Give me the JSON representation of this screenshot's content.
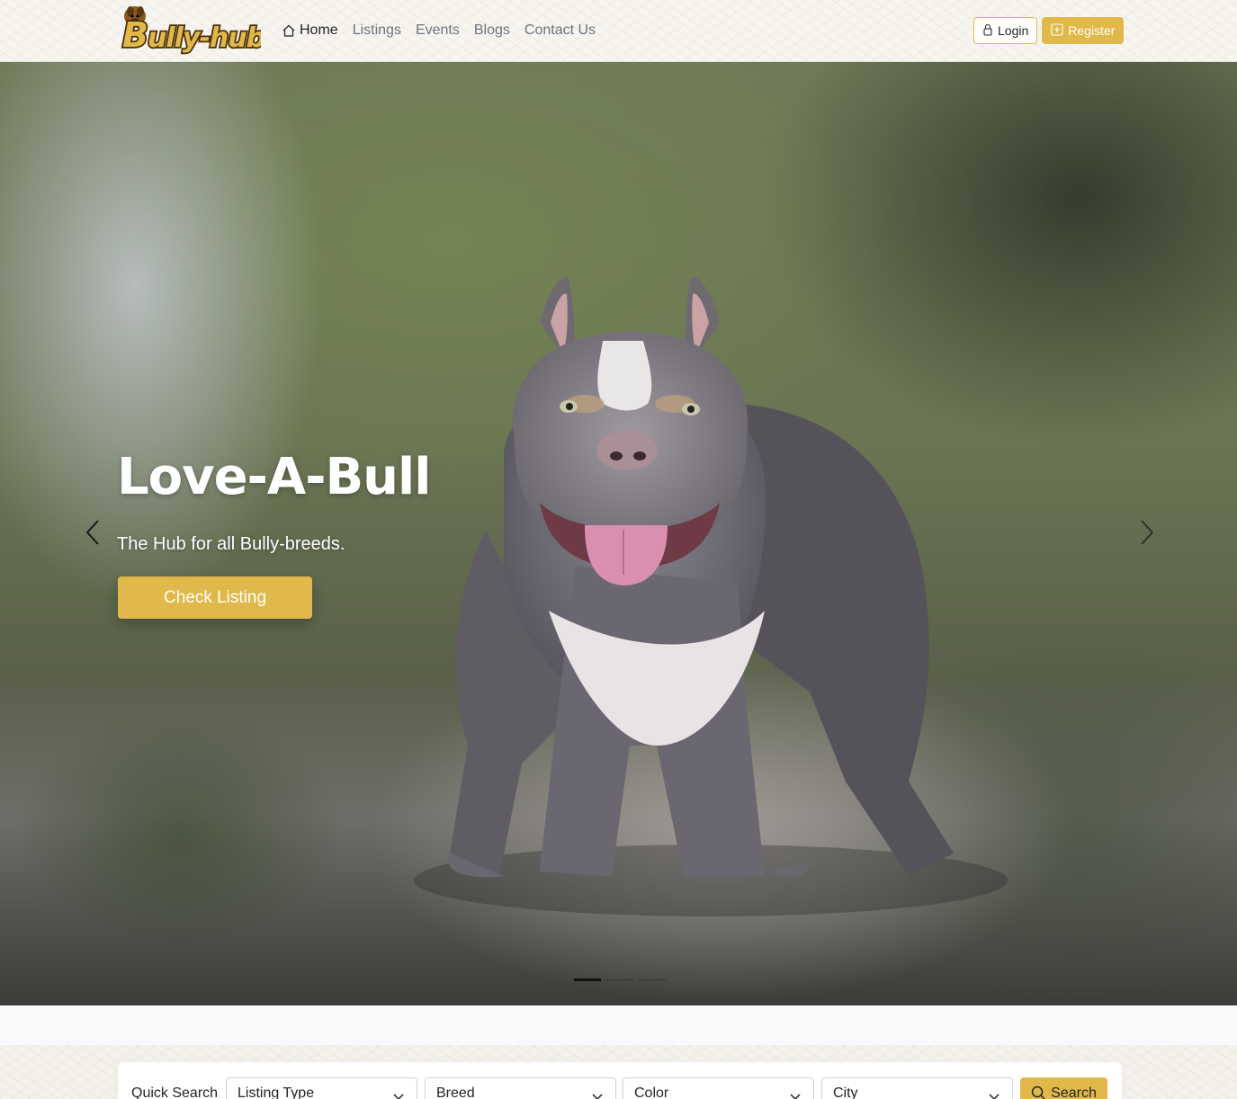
{
  "brand": {
    "logo_text": "Bully-hub",
    "accent_color": "#e0b94a"
  },
  "nav": {
    "home": "Home",
    "listings": "Listings",
    "events": "Events",
    "blogs": "Blogs",
    "contact": "Contact Us"
  },
  "auth": {
    "login": "Login",
    "register": "Register"
  },
  "hero": {
    "title": "Love-A-Bull",
    "subtitle": "The Hub for all Bully-breeds.",
    "cta": "Check Listing",
    "slide_count": 3,
    "active_slide": 1
  },
  "quick_search": {
    "label": "Quick Search",
    "listing_type": "Listing Type",
    "breed": "Breed",
    "color": "Color",
    "city": "City",
    "button": "Search"
  },
  "icons": {
    "home": "house-icon",
    "login": "lock-icon",
    "register": "plus-square-icon",
    "prev": "chevron-left-icon",
    "next": "chevron-right-icon",
    "search": "search-icon",
    "select": "chevron-down-icon"
  }
}
